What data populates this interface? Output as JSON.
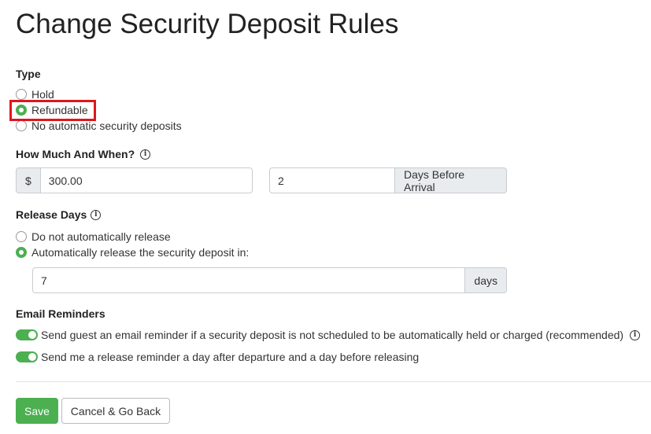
{
  "title": "Change Security Deposit Rules",
  "type_section": {
    "label": "Type",
    "options": [
      "Hold",
      "Refundable",
      "No automatic security deposits"
    ],
    "selected": "Refundable"
  },
  "amount_section": {
    "label": "How Much And When?",
    "info_icon": "info-icon",
    "currency_symbol": "$",
    "amount_value": "300.00",
    "days_value": "2",
    "days_suffix": "Days Before Arrival"
  },
  "release_section": {
    "label": "Release Days",
    "info_icon": "info-icon",
    "options": [
      "Do not automatically release",
      "Automatically release the security deposit in:"
    ],
    "selected": "Automatically release the security deposit in:",
    "days_value": "7",
    "days_suffix": "days"
  },
  "email_section": {
    "label": "Email Reminders",
    "reminders": [
      {
        "text": "Send guest an email reminder if a security deposit is not scheduled to be automatically held or charged (recommended)",
        "enabled": true
      },
      {
        "text": "Send me a release reminder a day after departure and a day before releasing",
        "enabled": true
      }
    ]
  },
  "buttons": {
    "save": "Save",
    "cancel": "Cancel & Go Back"
  },
  "colors": {
    "accent": "#4caf50",
    "highlight": "#e0161c"
  }
}
